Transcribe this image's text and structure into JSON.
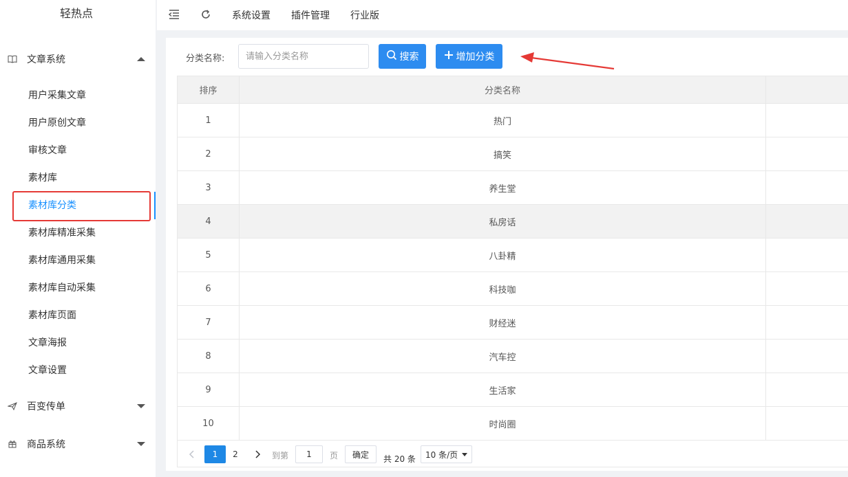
{
  "app": {
    "title": "轻热点"
  },
  "topbar": {
    "links": [
      "系统设置",
      "插件管理",
      "行业版"
    ]
  },
  "sidebar": {
    "groups": [
      {
        "label": "文章系统",
        "expanded": true
      },
      {
        "label": "百变传单",
        "expanded": false
      },
      {
        "label": "商品系统",
        "expanded": false
      }
    ],
    "items": [
      "用户采集文章",
      "用户原创文章",
      "审核文章",
      "素材库",
      "素材库分类",
      "素材库精准采集",
      "素材库通用采集",
      "素材库自动采集",
      "素材库页面",
      "文章海报",
      "文章设置"
    ],
    "active_item": "素材库分类"
  },
  "filter": {
    "label": "分类名称:",
    "placeholder": "请输入分类名称",
    "search_label": "搜索",
    "add_label": "增加分类"
  },
  "table": {
    "headers": [
      "排序",
      "分类名称",
      ""
    ],
    "rows": [
      [
        "1",
        "热门"
      ],
      [
        "2",
        "搞笑"
      ],
      [
        "3",
        "养生堂"
      ],
      [
        "4",
        "私房话"
      ],
      [
        "5",
        "八卦精"
      ],
      [
        "6",
        "科技咖"
      ],
      [
        "7",
        "财经迷"
      ],
      [
        "8",
        "汽车控"
      ],
      [
        "9",
        "生活家"
      ],
      [
        "10",
        "时尚圈"
      ]
    ]
  },
  "pagination": {
    "pages": [
      "1",
      "2"
    ],
    "current": "1",
    "goto_label": "到第",
    "goto_value": "1",
    "page_unit": "页",
    "confirm_label": "确定",
    "total_label": "共 20 条",
    "page_size": "10 条/页"
  },
  "colors": {
    "primary": "#2d8cf0",
    "active_text": "#1890ff",
    "annotation": "#e53935"
  }
}
